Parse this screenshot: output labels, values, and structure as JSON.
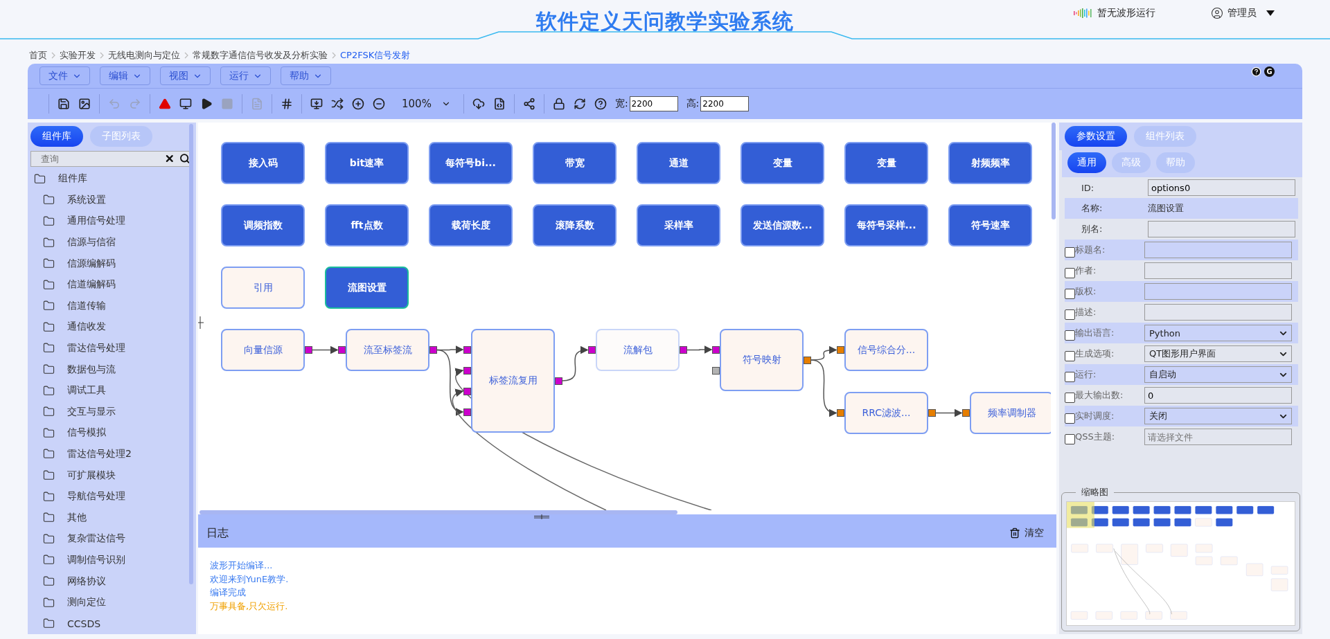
{
  "header": {
    "title": "软件定义天问教学实验系统",
    "status": "暂无波形运行",
    "user": "管理员"
  },
  "breadcrumb": [
    {
      "label": "首页",
      "selected": false
    },
    {
      "label": "实验开发",
      "selected": false
    },
    {
      "label": "无线电测向与定位",
      "selected": false
    },
    {
      "label": "常规数字通信信号收发及分析实验",
      "selected": false
    },
    {
      "label": "CP2FSK信号发射",
      "selected": true
    }
  ],
  "menu": [
    "文件",
    "编辑",
    "视图",
    "运行",
    "帮助"
  ],
  "panel_badge": "G",
  "toolbar": [
    [
      {
        "kind": "save",
        "disabled": false
      },
      {
        "kind": "image",
        "disabled": false
      }
    ],
    [
      {
        "kind": "undo",
        "disabled": true
      },
      {
        "kind": "redo",
        "disabled": true
      }
    ],
    [
      {
        "kind": "warning",
        "disabled": false
      },
      {
        "kind": "monitor",
        "disabled": false
      },
      {
        "kind": "play",
        "disabled": false
      },
      {
        "kind": "stop",
        "disabled": true
      }
    ],
    [
      {
        "kind": "document",
        "disabled": true
      }
    ],
    [
      {
        "kind": "grid",
        "disabled": false
      }
    ],
    [
      {
        "kind": "screen",
        "disabled": false
      },
      {
        "kind": "shuffle",
        "disabled": false
      },
      {
        "kind": "zoom-in",
        "disabled": false
      },
      {
        "kind": "zoom-out",
        "disabled": false
      },
      {
        "kind": "zoom",
        "label": "100%"
      }
    ],
    [
      {
        "kind": "cloud",
        "disabled": false
      },
      {
        "kind": "code",
        "disabled": false
      }
    ],
    [
      {
        "kind": "share",
        "disabled": false
      }
    ],
    [
      {
        "kind": "lock",
        "disabled": false
      },
      {
        "kind": "refresh",
        "disabled": false
      },
      {
        "kind": "help",
        "disabled": false
      },
      {
        "kind": "size",
        "label": "宽:",
        "value": "2200"
      },
      {
        "kind": "size",
        "label": "高:",
        "value": "2200"
      }
    ]
  ],
  "sidebar": {
    "tabs": [
      {
        "label": "组件库",
        "selected": true
      },
      {
        "label": "子图列表",
        "selected": false
      }
    ],
    "search": {
      "placeholder": "查询"
    },
    "tree": [
      {
        "label": "组件库",
        "children": [
          {
            "label": "系统设置"
          },
          {
            "label": "通用信号处理"
          },
          {
            "label": "信源与信宿"
          },
          {
            "label": "信源编解码"
          },
          {
            "label": "信道编解码"
          },
          {
            "label": "信道传输"
          },
          {
            "label": "通信收发"
          },
          {
            "label": "雷达信号处理"
          },
          {
            "label": "数据包与流"
          },
          {
            "label": "调试工具"
          },
          {
            "label": "交互与显示"
          },
          {
            "label": "信号模拟"
          },
          {
            "label": "雷达信号处理2"
          },
          {
            "label": "可扩展模块"
          },
          {
            "label": "导航信号处理"
          },
          {
            "label": "其他"
          },
          {
            "label": "复杂雷达信号"
          },
          {
            "label": "调制信号识别"
          },
          {
            "label": "网络协议"
          },
          {
            "label": "测向定位"
          },
          {
            "label": "CCSDS"
          }
        ]
      }
    ]
  },
  "canvas": {
    "palette_nodes": [
      {
        "label": "接入码",
        "kind": "variable",
        "selected": false
      },
      {
        "label": "bit速率",
        "kind": "variable",
        "selected": false
      },
      {
        "label": "每符号bi...",
        "kind": "variable",
        "selected": false
      },
      {
        "label": "带宽",
        "kind": "variable",
        "selected": false
      },
      {
        "label": "通道",
        "kind": "variable",
        "selected": false
      },
      {
        "label": "变量",
        "kind": "variable",
        "selected": false
      },
      {
        "label": "变量",
        "kind": "variable",
        "selected": false
      },
      {
        "label": "射频频率",
        "kind": "variable",
        "selected": false
      },
      {
        "label": "调频指数",
        "kind": "variable",
        "selected": false
      },
      {
        "label": "fft点数",
        "kind": "variable",
        "selected": false
      },
      {
        "label": "载荷长度",
        "kind": "variable",
        "selected": false
      },
      {
        "label": "滚降系数",
        "kind": "variable",
        "selected": false
      },
      {
        "label": "采样率",
        "kind": "variable",
        "selected": false
      },
      {
        "label": "发送信源数...",
        "kind": "variable",
        "selected": false
      },
      {
        "label": "每符号采样...",
        "kind": "variable",
        "selected": false
      },
      {
        "label": "符号速率",
        "kind": "variable",
        "selected": false
      },
      {
        "label": "引用",
        "kind": "block",
        "selected": false
      },
      {
        "label": "流图设置",
        "kind": "variable",
        "selected": true
      }
    ],
    "flow_nodes": [
      {
        "label": "向量信源",
        "disabled": false,
        "out_ports": [
          {
            "color": "#cc00cc"
          }
        ]
      },
      {
        "label": "流至标签流",
        "disabled": false,
        "in_ports": [
          {
            "color": "#cc00cc"
          }
        ],
        "out_ports": [
          {
            "color": "#cc00cc"
          }
        ]
      },
      {
        "label": "标签流复用",
        "disabled": false,
        "in_ports": [
          {
            "color": "#cc00cc"
          },
          {
            "color": "#cc00cc"
          },
          {
            "color": "#cc00cc"
          },
          {
            "color": "#cc00cc"
          }
        ],
        "out_ports": [
          {
            "color": "#cc00cc"
          }
        ]
      },
      {
        "label": "流解包",
        "disabled": true,
        "in_ports": [
          {
            "color": "#cc00cc"
          }
        ],
        "out_ports": [
          {
            "color": "#cc00cc"
          }
        ]
      },
      {
        "label": "符号映射",
        "disabled": false,
        "in_ports": [
          {
            "color": "#cc00cc"
          },
          {
            "color": "#b3b3b3"
          }
        ],
        "out_ports": [
          {
            "color": "#e67e00"
          }
        ]
      },
      {
        "label": "信号综合分...",
        "disabled": false,
        "in_ports": [
          {
            "color": "#e67e00"
          }
        ]
      },
      {
        "label": "RRC滤波...",
        "disabled": false,
        "in_ports": [
          {
            "color": "#e67e00"
          }
        ],
        "out_ports": [
          {
            "color": "#e67e00"
          }
        ]
      },
      {
        "label": "频率调制器",
        "disabled": false,
        "in_ports": [
          {
            "color": "#e67e00"
          }
        ]
      }
    ]
  },
  "log": {
    "title": "日志",
    "clear": "清空",
    "lines": [
      {
        "text": "波形开始编译...",
        "kind": "info"
      },
      {
        "text": "欢迎来到YunE教学.",
        "kind": "info"
      },
      {
        "text": "编译完成",
        "kind": "info"
      },
      {
        "text": "万事具备,只欠运行.",
        "kind": "warning"
      }
    ]
  },
  "properties": {
    "tabs": [
      {
        "label": "参数设置",
        "selected": true
      },
      {
        "label": "组件列表",
        "selected": false
      }
    ],
    "subtabs": [
      {
        "label": "通用",
        "selected": true
      },
      {
        "label": "高级",
        "selected": false
      },
      {
        "label": "帮助",
        "selected": false
      }
    ],
    "rows": [
      {
        "label": "ID:",
        "kind": "input",
        "value": "options0"
      },
      {
        "label": "名称:",
        "kind": "text",
        "value": "流图设置"
      },
      {
        "label": "别名:",
        "kind": "input"
      },
      {
        "label": "标题名:",
        "kind": "input",
        "checked": false
      },
      {
        "label": "作者:",
        "kind": "input",
        "checked": false
      },
      {
        "label": "版权:",
        "kind": "input",
        "checked": false
      },
      {
        "label": "描述:",
        "kind": "input",
        "checked": false
      },
      {
        "label": "输出语言:",
        "kind": "select",
        "value": "Python",
        "checked": false
      },
      {
        "label": "生成选项:",
        "kind": "select",
        "value": "QT图形用户界面",
        "checked": false
      },
      {
        "label": "运行:",
        "kind": "select",
        "value": "自启动",
        "checked": false
      },
      {
        "label": "最大输出数:",
        "kind": "input",
        "value": "0",
        "checked": false
      },
      {
        "label": "实时调度:",
        "kind": "select",
        "value": "关闭",
        "checked": false
      },
      {
        "label": "QSS主题:",
        "kind": "input",
        "placeholder": "请选择文件",
        "checked": false
      }
    ],
    "minimap_title": "缩略图"
  }
}
